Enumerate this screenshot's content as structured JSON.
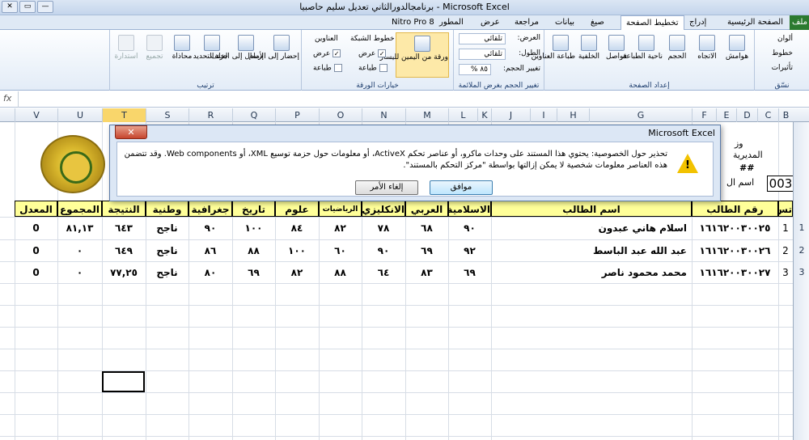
{
  "window": {
    "title": "برنامجالدورالثاني تعديل سليم حاصبيا - Microsoft Excel",
    "extra": "Nitro Pro 8",
    "controls": [
      "✕",
      "▭",
      "—"
    ]
  },
  "tabs": [
    "ملف",
    "الصفحة الرئيسية",
    "إدراج",
    "تخطيط الصفحة",
    "صيغ",
    "بيانات",
    "مراجعة",
    "عرض",
    "المطور"
  ],
  "ribbon": {
    "groups": {
      "themes": "نسّق",
      "page_setup": "إعداد الصفحة",
      "scale": "تغيير الحجم بغرض الملائمة",
      "sheet_options": "خيارات الورقة",
      "arrange": "ترتيب"
    },
    "themes": {
      "colors": "ألوان",
      "fonts": "خطوط",
      "effects": "تأثيرات"
    },
    "page_setup": {
      "margins": "هوامش",
      "orientation": "الاتجاه",
      "size": "الحجم",
      "print_area": "ناحية الطباعة",
      "breaks": "فواصل",
      "background": "الخلفية",
      "print_titles": "طباعة العناوين"
    },
    "scale": {
      "width_label": "العرض:",
      "width_value": "تلقائي",
      "height_label": "الطول:",
      "height_value": "تلقائي",
      "scale_label": "تغيير الحجم:",
      "scale_value": "٨٥ %"
    },
    "sheet_options": {
      "rtl": "ورقة من اليمين لليسار",
      "gridlines": "خطوط الشبكة",
      "headings": "العناوين",
      "view": "عرض",
      "print": "طباعة",
      "check": "✓"
    },
    "arrange": {
      "bring_forward": "إحضار إلى الأمام",
      "send_backward": "إرسال إلى الخلف",
      "selection_pane": "جزء التحديد",
      "align": "محاذاة",
      "group": "تجميع",
      "rotate": "استدارة"
    }
  },
  "formula_bar": {
    "fx": "fx"
  },
  "columns": [
    "B",
    "C",
    "D",
    "E",
    "F",
    "G",
    "H",
    "I",
    "J",
    "K",
    "L",
    "M",
    "N",
    "O",
    "P",
    "Q",
    "R",
    "S",
    "T",
    "U",
    "V"
  ],
  "rows": [
    "1",
    "2",
    "3"
  ],
  "partial": {
    "p1": "وز",
    "p2": "المديرية",
    "p3": "##",
    "p4": "اسم ال",
    "box": "003"
  },
  "table": {
    "headers": {
      "seq": "تس",
      "student_no": "رقم الطالب",
      "student_name": "اسم الطالب",
      "islamic": "الاسلامية",
      "arabic": "العربي",
      "english": "الانكليزي",
      "math": "الرياضيات",
      "science": "علوم",
      "history": "تاريخ",
      "geography": "جغرافية",
      "national": "وطنية",
      "result": "النتيجة",
      "total": "المجموع",
      "average": "المعدل"
    },
    "rows": [
      {
        "seq": "1",
        "student_no": "١٦١٦٢٠٠٣٠٠٢٥",
        "student_name": "اسلام هاني عبدون",
        "islamic": "٩٠",
        "arabic": "٦٨",
        "english": "٧٨",
        "math": "٨٢",
        "science": "٨٤",
        "history": "١٠٠",
        "geography": "٩٠",
        "national": "ناجح",
        "result": "٦٤٣",
        "total": "٨١,١٣",
        "average": "0"
      },
      {
        "seq": "2",
        "student_no": "١٦١٦٢٠٠٣٠٠٢٦",
        "student_name": "عبد الله عبد الباسط",
        "islamic": "٩٢",
        "arabic": "٦٩",
        "english": "٩٠",
        "math": "٦٠",
        "science": "١٠٠",
        "history": "٨٨",
        "geography": "٨٦",
        "national": "ناجح",
        "result": "٦٤٩",
        "total": "٠",
        "average": "0"
      },
      {
        "seq": "3",
        "student_no": "١٦١٦٢٠٠٣٠٠٢٧",
        "student_name": "محمد محمود ناصر",
        "islamic": "٦٩",
        "arabic": "٨٣",
        "english": "٦٤",
        "math": "٨٨",
        "science": "٨٢",
        "history": "٦٩",
        "geography": "٨٠",
        "national": "ناجح",
        "result": "٧٧,٢٥",
        "total": "٠",
        "average": "0"
      }
    ]
  },
  "dialog": {
    "title": "Microsoft Excel",
    "close": "✕",
    "message": "تحذير حول الخصوصية: يحتوي هذا المستند على وحدات ماكرو، أو عناصر تحكم ActiveX، أو معلومات حول حزمة توسيع XML، أو Web components. وقد تتضمن هذه العناصر معلومات شخصية لا يمكن إزالتها بواسطة \"مركز التحكم بالمستند\".",
    "ok": "موافق",
    "cancel": "إلغاء الأمر",
    "warn_glyph": "!"
  }
}
